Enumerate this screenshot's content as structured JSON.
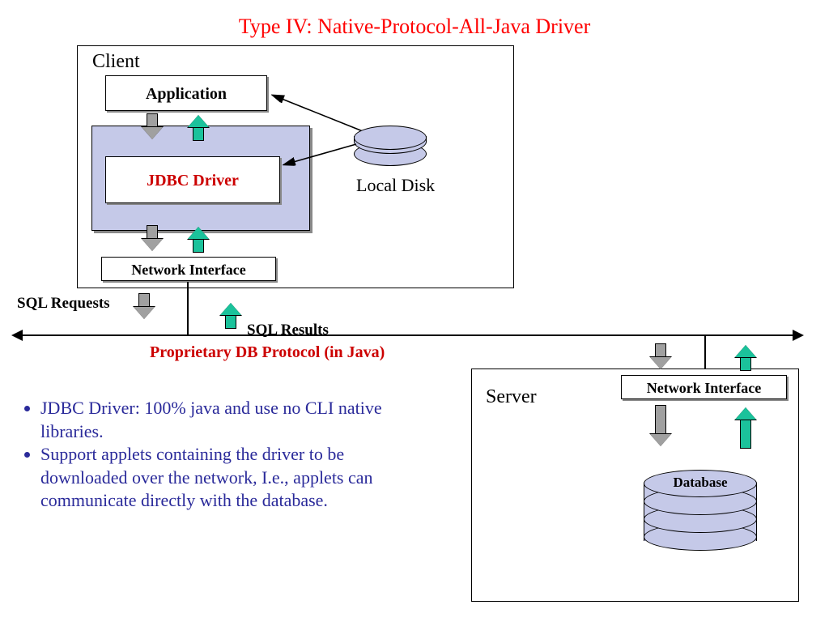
{
  "title": "Type IV: Native-Protocol-All-Java Driver",
  "client": {
    "label": "Client",
    "application": "Application",
    "jdbc": "JDBC Driver",
    "network_if": "Network Interface",
    "local_disk": "Local Disk"
  },
  "server": {
    "label": "Server",
    "network_if": "Network Interface",
    "database": "Database"
  },
  "protocol": {
    "sql_requests": "SQL Requests",
    "sql_results": "SQL Results",
    "line_label": "Proprietary DB Protocol (in Java)"
  },
  "bullets": [
    "JDBC Driver: 100% java and use no CLI native libraries.",
    "Support applets containing the driver to be downloaded over the network, I.e., applets can communicate directly with the database."
  ]
}
